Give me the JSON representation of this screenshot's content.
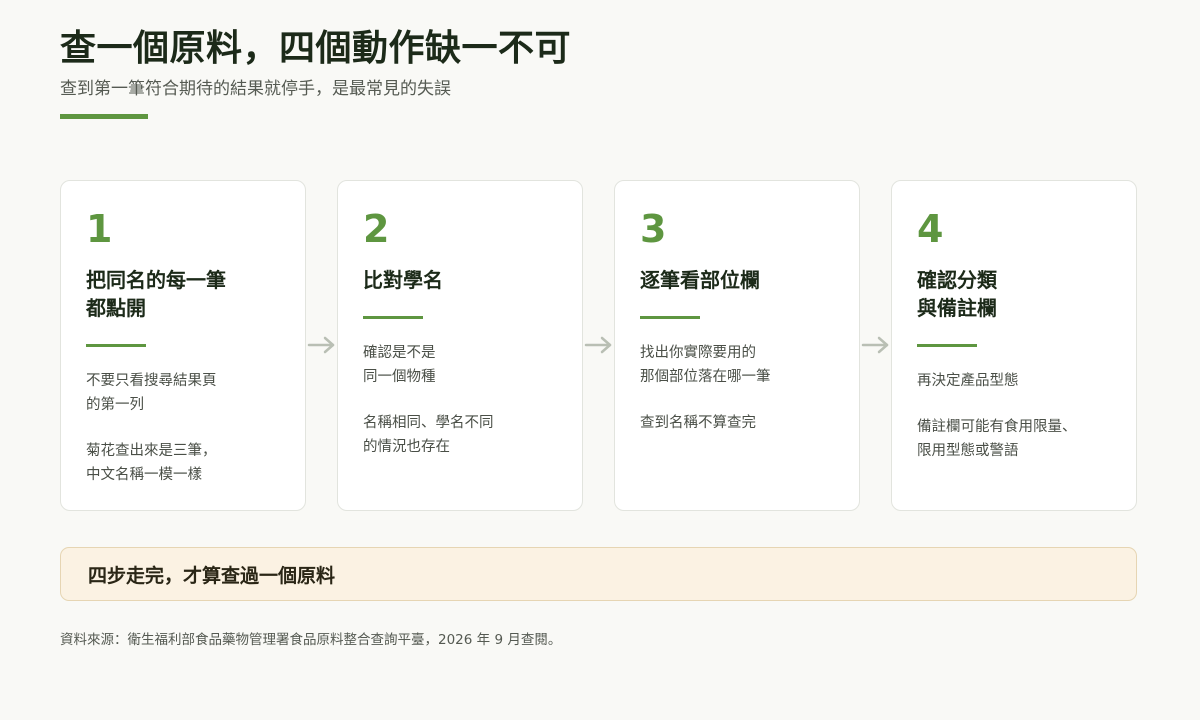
{
  "header": {
    "title": "查一個原料，四個動作缺一不可",
    "subtitle": "查到第一筆符合期待的結果就停手，是最常見的失誤"
  },
  "steps": [
    {
      "number": "1",
      "title": "把同名的每一筆\n都點開",
      "paragraphs": [
        "不要只看搜尋結果頁\n的第一列",
        "菊花查出來是三筆，\n中文名稱一模一樣"
      ]
    },
    {
      "number": "2",
      "title": "比對學名",
      "paragraphs": [
        "確認是不是\n同一個物種",
        "名稱相同、學名不同\n的情況也存在"
      ]
    },
    {
      "number": "3",
      "title": "逐筆看部位欄",
      "paragraphs": [
        "找出你實際要用的\n那個部位落在哪一筆",
        "查到名稱不算查完"
      ]
    },
    {
      "number": "4",
      "title": "確認分類\n與備註欄",
      "paragraphs": [
        "再決定產品型態",
        "備註欄可能有食用限量、\n限用型態或警語"
      ]
    }
  ],
  "banner": {
    "text": "四步走完，才算查過一個原料"
  },
  "footer": {
    "source": "資料來源：衛生福利部食品藥物管理署食品原料整合查詢平臺，2026 年 9 月查閱。"
  },
  "colors": {
    "accent": "#5e9640",
    "arrow": "#b9bfb4",
    "banner_bg": "#fbf2e3",
    "banner_border": "#e6d5b3",
    "card_border": "#e2e4de",
    "page_bg": "#f9f9f6"
  },
  "icons": {
    "connector": "arrow-right-icon"
  }
}
